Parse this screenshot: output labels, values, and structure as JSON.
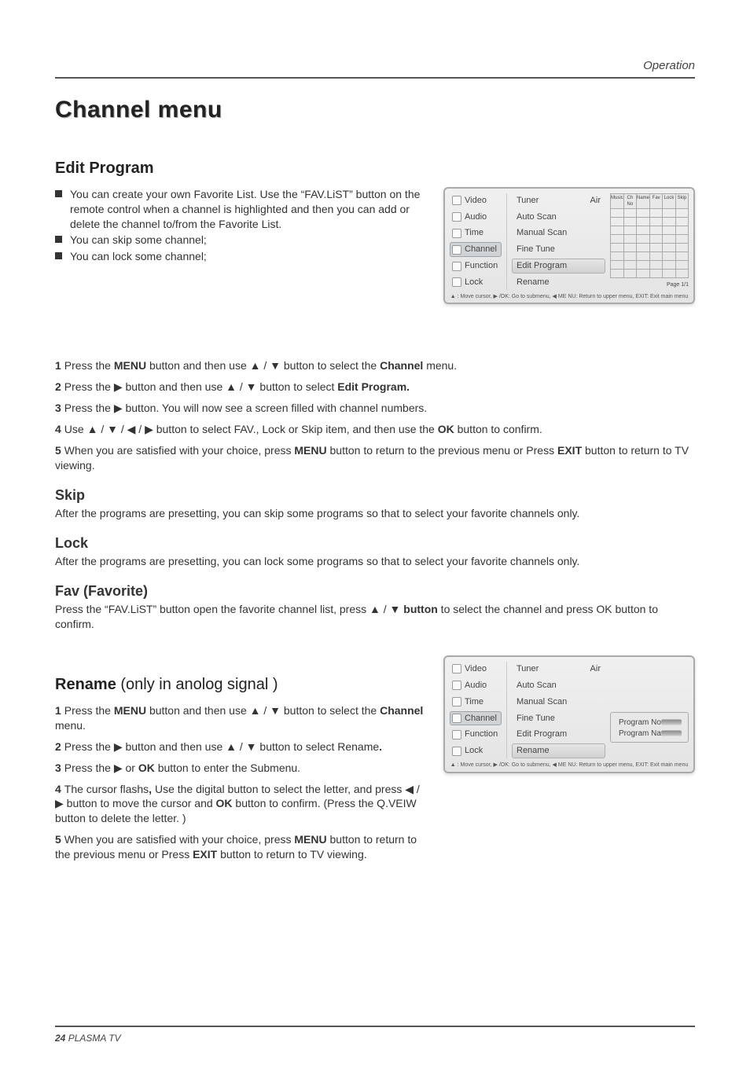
{
  "header": {
    "section": "Operation"
  },
  "title": "Channel menu",
  "edit_program": {
    "heading": "Edit Program",
    "bullets": [
      "You can create your own Favorite List. Use the “FAV.LiST” button on the remote control when a channel is highlighted and then you can add or delete the channel to/from the Favorite List.",
      "You can skip some channel;",
      "You can lock some channel;"
    ],
    "steps": {
      "s1_a": "Press the ",
      "s1_b": "MENU",
      "s1_c": " button and then use ▲ / ▼ button to select the ",
      "s1_d": "Channel",
      "s1_e": " menu.",
      "s2_a": "Press the ▶ button and then use ▲ / ▼ button to select ",
      "s2_b": "Edit Program.",
      "s3": "Press the ▶ button. You will now see a screen filled with channel numbers.",
      "s4_a": "Use ▲ / ▼ / ◀ / ▶ button to select FAV., Lock or Skip item,  and then use the ",
      "s4_b": "OK",
      "s4_c": " button to confirm.",
      "s5_a": "When you are satisfied with your choice,  press ",
      "s5_b": "MENU",
      "s5_c": " button to return to the previous menu or Press ",
      "s5_d": "EXIT",
      "s5_e": " button to return to TV viewing."
    }
  },
  "skip": {
    "heading": "Skip",
    "body": "After the programs are presetting, you can skip some programs so that to select your  favorite channels only."
  },
  "lock": {
    "heading": "Lock",
    "body": "After the programs are presetting, you can lock some programs so that to select your  favorite channels only."
  },
  "fav": {
    "heading": "Fav (Favorite)",
    "body_a": "Press the “FAV.LiST” button open the favorite channel list, press ▲ / ▼ ",
    "body_b": "button",
    "body_c": " to select the channel and press OK button to confirm."
  },
  "rename": {
    "heading_a": "Rename",
    "heading_b": " (only in anolog signal )",
    "steps": {
      "s1_a": "Press the ",
      "s1_b": "MENU",
      "s1_c": " button and then use ▲ / ▼ button to select the ",
      "s1_d": "Channel",
      "s1_e": " menu.",
      "s2_a": "Press the ▶ button and then use ▲ / ▼ button to select Rename",
      "s2_b": ".",
      "s3_a": "Press the ▶ or ",
      "s3_b": "OK",
      "s3_c": " button to enter the Submenu.",
      "s4_a": "The cursor flashs",
      "s4_b": ",",
      "s4_c": " Use the digital button to select the letter, and press ◀ / ▶ button to move the cursor and ",
      "s4_d": "OK",
      "s4_e": " button to confirm. (Press  the Q.VEIW button to delete the letter. )",
      "s5_a": "When you are satisfied with your choice,  press ",
      "s5_b": "MENU",
      "s5_c": " button to return to the previous menu or Press ",
      "s5_d": "EXIT",
      "s5_e": " button to return to TV viewing."
    }
  },
  "osd": {
    "sidebar": [
      "Video",
      "Audio",
      "Time",
      "Channel",
      "Function",
      "Lock"
    ],
    "sidebar_sel": 3,
    "main": [
      {
        "label": "Tuner",
        "value": "Air"
      },
      {
        "label": "Auto Scan",
        "value": ""
      },
      {
        "label": "Manual Scan",
        "value": ""
      },
      {
        "label": "Fine Tune",
        "value": ""
      },
      {
        "label": "Edit Program",
        "value": ""
      },
      {
        "label": "Rename",
        "value": ""
      }
    ],
    "sel1": 4,
    "sel2": 5,
    "grid_headers": [
      "Music",
      "Ch No",
      "Name",
      "Fav",
      "Lock",
      "Skip"
    ],
    "grid_rows": 8,
    "page": "Page 1/1",
    "info": [
      "Program No",
      "Program Name"
    ],
    "help": "▲ : Move cursor,  ▶ /OK: Go to submenu,  ◀ ME NU: Return to upper menu, EXIT: Exit main menu"
  },
  "footer": {
    "num": "24",
    "label": "  PLASMA TV"
  }
}
